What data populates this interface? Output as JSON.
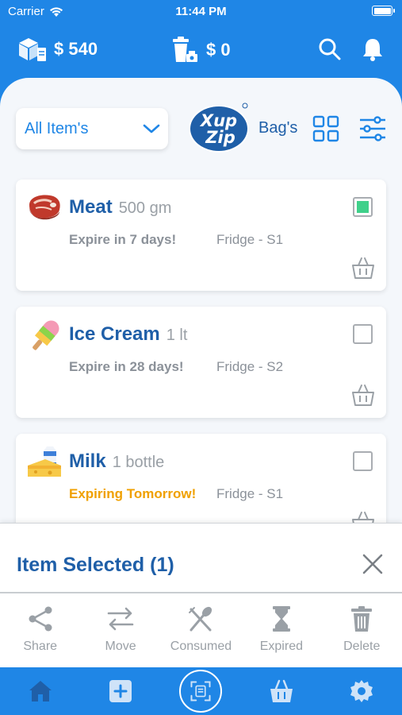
{
  "status": {
    "carrier": "Carrier",
    "time": "11:44 PM"
  },
  "header": {
    "wallet_balance": "$ 540",
    "recycle_balance": "$ 0"
  },
  "toolbar": {
    "filter_value": "All Item's",
    "bags_label": "Bag's",
    "logo_text": "Xup Zip"
  },
  "items": [
    {
      "name": "Meat",
      "quantity": "500 gm",
      "expiry": "Expire in 7 days!",
      "location": "Fridge - S1",
      "selected": true
    },
    {
      "name": "Ice Cream",
      "quantity": "1 lt",
      "expiry": "Expire in 28 days!",
      "location": "Fridge - S2",
      "selected": false
    },
    {
      "name": "Milk",
      "quantity": "1 bottle",
      "expiry": "Expiring Tomorrow!",
      "location": "Fridge - S1",
      "selected": false
    }
  ],
  "selection": {
    "title": "Item Selected (1)",
    "actions": [
      {
        "label": "Share",
        "icon": "share-icon"
      },
      {
        "label": "Move",
        "icon": "move-arrows-icon"
      },
      {
        "label": "Consumed",
        "icon": "fork-spoon-icon"
      },
      {
        "label": "Expired",
        "icon": "hourglass-icon"
      },
      {
        "label": "Delete",
        "icon": "trash-icon"
      }
    ]
  },
  "nav": [
    "home-icon",
    "add-icon",
    "scan-icon",
    "basket-icon",
    "settings-icon"
  ],
  "colors": {
    "primary": "#1f86e6",
    "title_blue": "#1f5fa8",
    "checked": "#3fd08a",
    "warning": "#f0a000",
    "muted": "#9aa0a6"
  }
}
